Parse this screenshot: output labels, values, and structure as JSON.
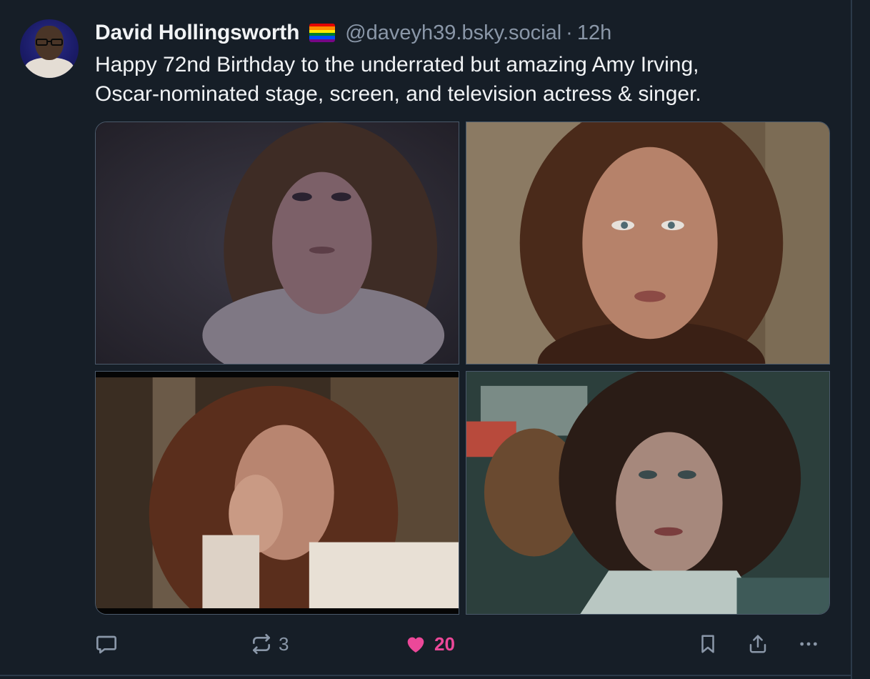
{
  "post": {
    "author": {
      "display_name": "David Hollingsworth",
      "flag_icon": "rainbow-flag-emoji",
      "handle": "@daveyh39.bsky.social",
      "separator": "·",
      "time": "12h"
    },
    "text": "Happy 72nd Birthday to the underrated but amazing Amy Irving,\nOscar-nominated stage, screen, and television actress & singer.",
    "images": [
      {
        "icon": "photo",
        "tone": "dim bluish purple"
      },
      {
        "icon": "photo",
        "tone": "warm brown"
      },
      {
        "icon": "photo",
        "tone": "warm sepia"
      },
      {
        "icon": "photo",
        "tone": "cool green-teal"
      }
    ],
    "actions": {
      "reply": {
        "icon": "speech-bubble-icon",
        "count": ""
      },
      "repost": {
        "icon": "repost-arrows-icon",
        "count": "3"
      },
      "like": {
        "icon": "heart-icon",
        "count": "20",
        "color": "#ec4899"
      },
      "bookmark": {
        "icon": "bookmark-icon"
      },
      "share": {
        "icon": "share-icon"
      },
      "more": {
        "icon": "more-dots-icon"
      }
    }
  },
  "colors": {
    "background": "#161e27",
    "text": "#f1f3f5",
    "muted": "#8a97a8",
    "like": "#ec4899"
  }
}
